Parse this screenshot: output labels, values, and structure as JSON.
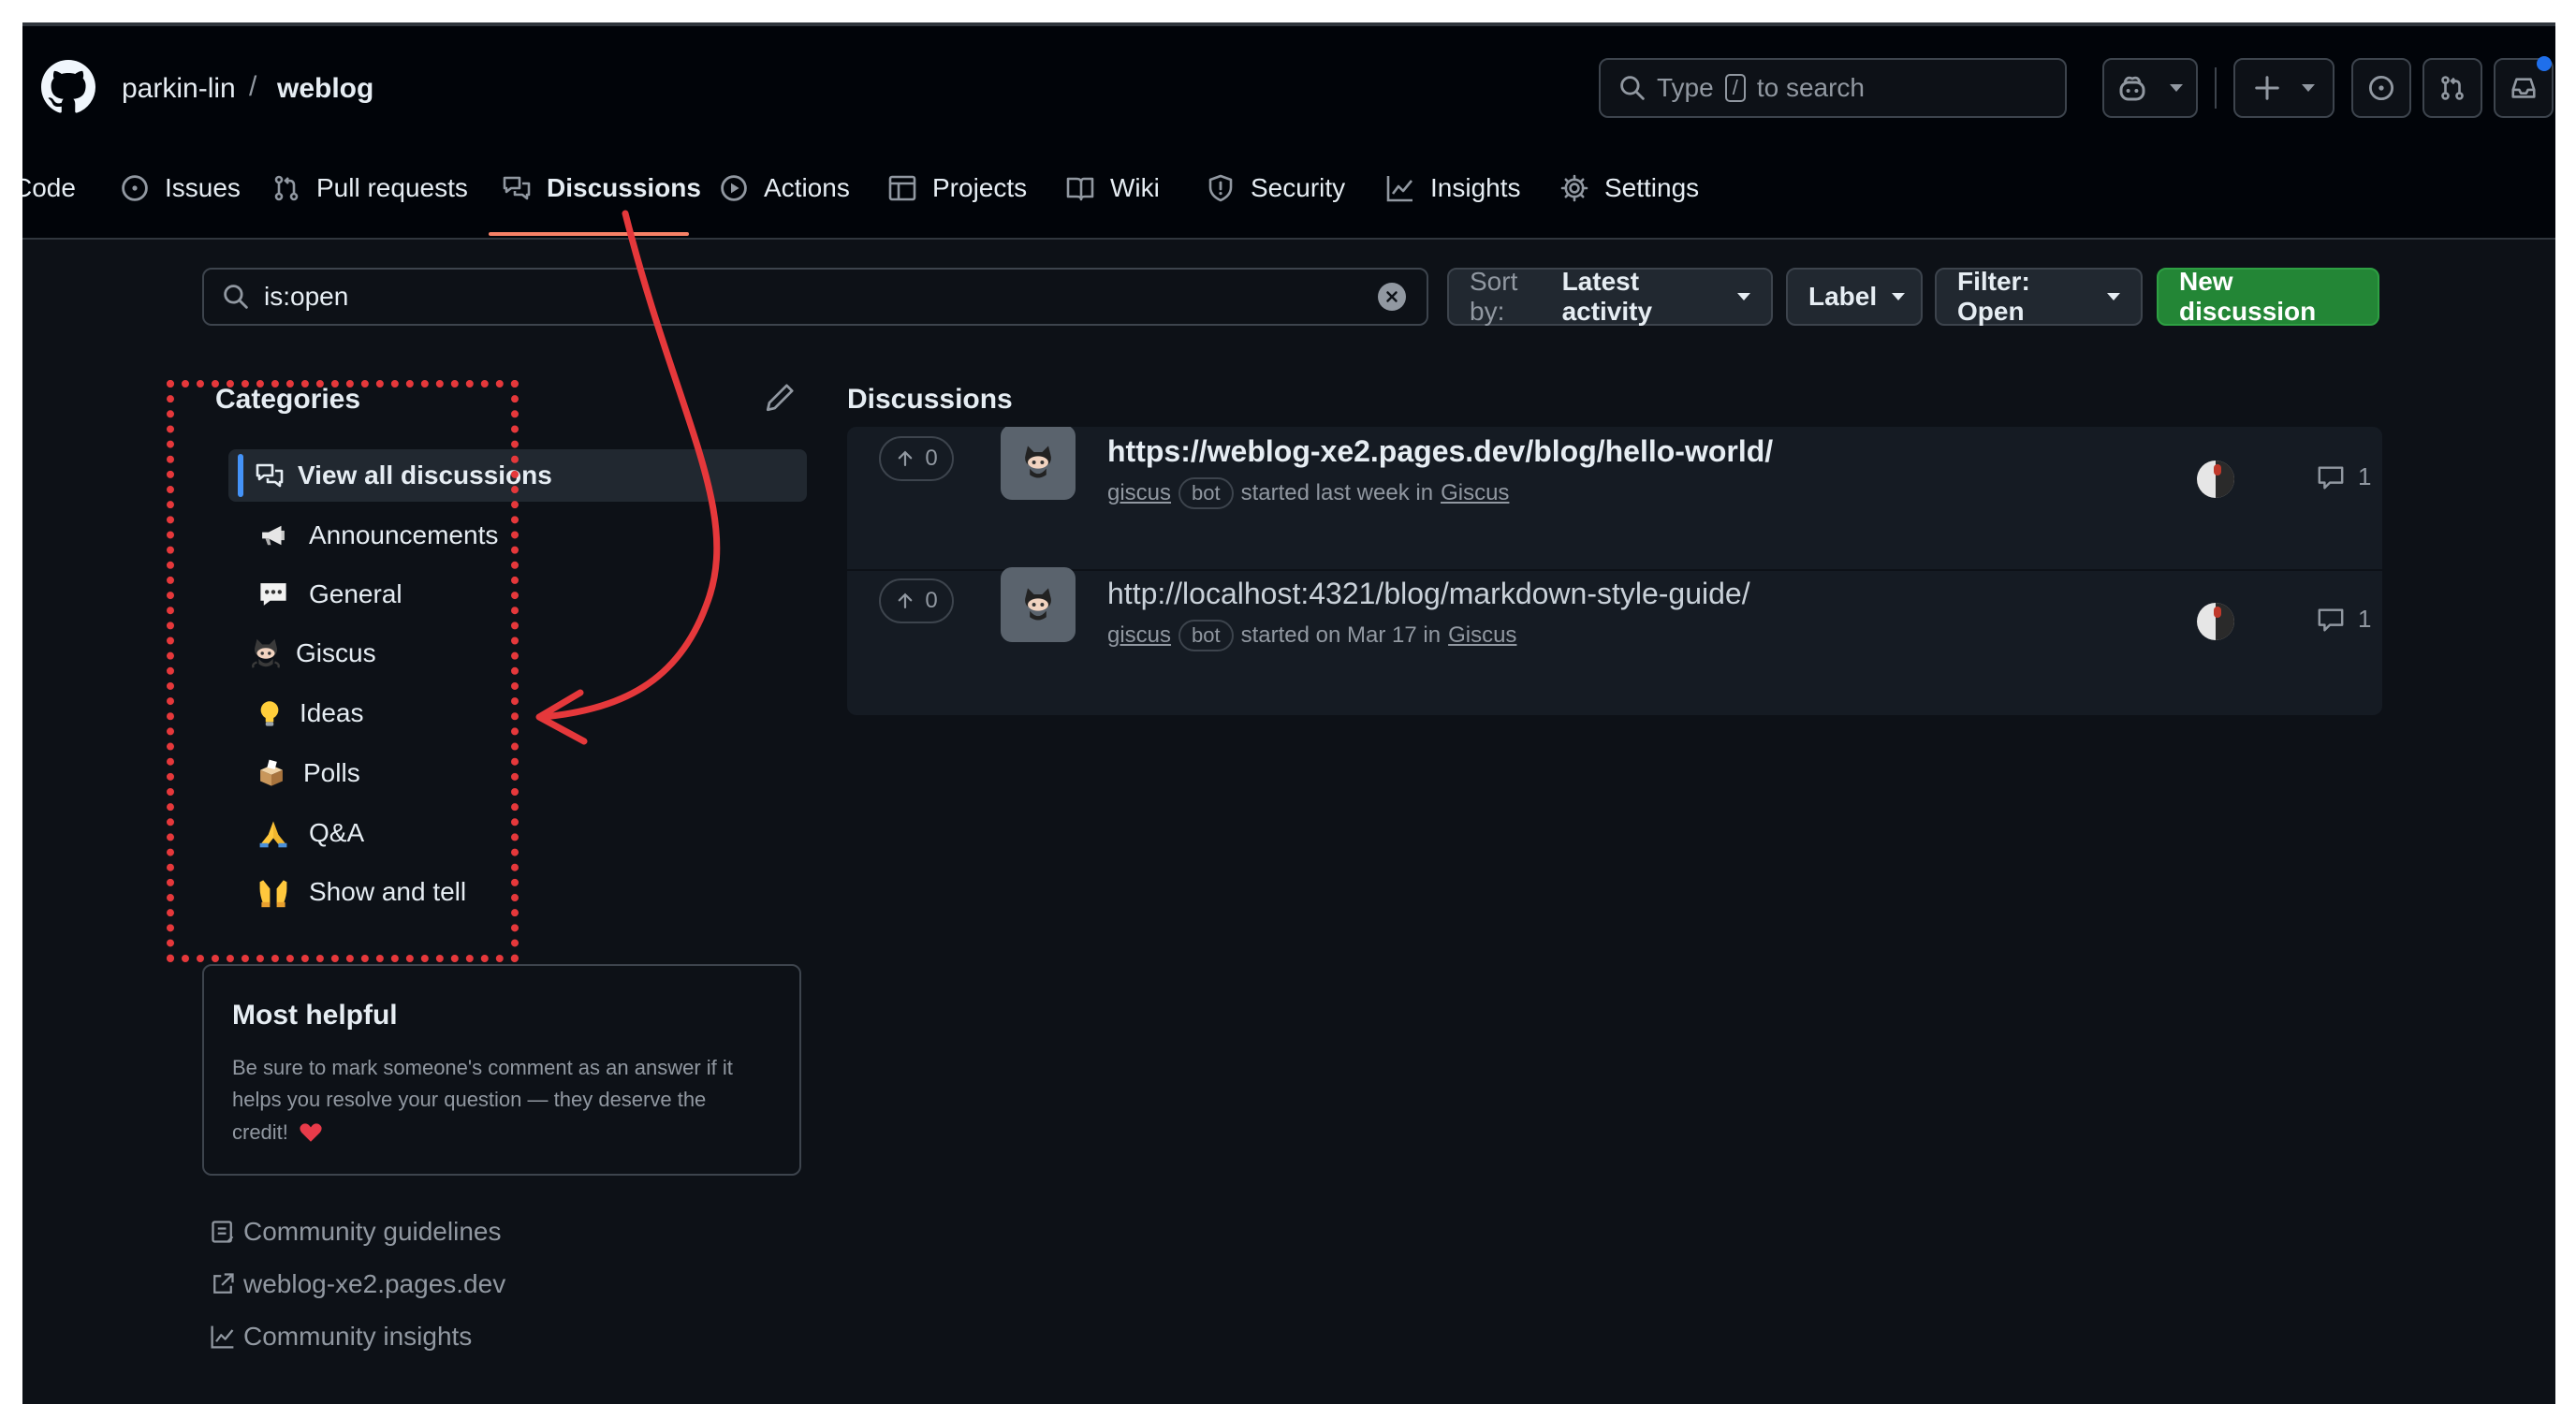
{
  "header": {
    "owner": "parkin-lin",
    "separator": "/",
    "repo": "weblog",
    "search": {
      "prefix": "Type",
      "key": "/",
      "suffix": "to search"
    },
    "notification_dot_color": "#1f6feb"
  },
  "tabs": [
    {
      "label": "Code",
      "icon": "code-icon"
    },
    {
      "label": "Issues",
      "icon": "issue-opened-icon"
    },
    {
      "label": "Pull requests",
      "icon": "git-pull-request-icon"
    },
    {
      "label": "Discussions",
      "icon": "comment-discussion-icon",
      "selected": true
    },
    {
      "label": "Actions",
      "icon": "play-icon"
    },
    {
      "label": "Projects",
      "icon": "table-icon"
    },
    {
      "label": "Wiki",
      "icon": "book-icon"
    },
    {
      "label": "Security",
      "icon": "shield-icon"
    },
    {
      "label": "Insights",
      "icon": "graph-icon"
    },
    {
      "label": "Settings",
      "icon": "gear-icon"
    }
  ],
  "toolbar": {
    "search_value": "is:open",
    "sort_prefix": "Sort by:",
    "sort_value": "Latest activity",
    "label_button": "Label",
    "filter_button": "Filter: Open",
    "new_discussion": "New discussion",
    "accent_green": "#238636"
  },
  "categories": {
    "title": "Categories",
    "items": [
      {
        "label": "View all discussions",
        "emoji": "discussion-outline-icon",
        "selected": true
      },
      {
        "label": "Announcements",
        "emoji": "megaphone-emoji"
      },
      {
        "label": "General",
        "emoji": "speech-balloon-emoji"
      },
      {
        "label": "Giscus",
        "emoji": "octocat-emoji"
      },
      {
        "label": "Ideas",
        "emoji": "lightbulb-emoji"
      },
      {
        "label": "Polls",
        "emoji": "ballot-box-emoji"
      },
      {
        "label": "Q&A",
        "emoji": "folded-hands-emoji"
      },
      {
        "label": "Show and tell",
        "emoji": "raising-hands-emoji"
      }
    ]
  },
  "most_helpful": {
    "title": "Most helpful",
    "body_line1": "Be sure to mark someone's comment as an answer if it",
    "body_line2": "helps you resolve your question — they deserve the",
    "body_line3": "credit!"
  },
  "footer_links": [
    {
      "label": "Community guidelines",
      "icon": "note-icon"
    },
    {
      "label": "weblog-xe2.pages.dev",
      "icon": "link-external-icon"
    },
    {
      "label": "Community insights",
      "icon": "graph-icon"
    }
  ],
  "discussions": {
    "heading": "Discussions",
    "rows": [
      {
        "votes": "0",
        "title": "https://weblog-xe2.pages.dev/blog/hello-world/",
        "author": "giscus",
        "badge": "bot",
        "started": "started last week in",
        "category": "Giscus",
        "comments": "1"
      },
      {
        "votes": "0",
        "title": "http://localhost:4321/blog/markdown-style-guide/",
        "author": "giscus",
        "badge": "bot",
        "started": "started on Mar 17 in",
        "category": "Giscus",
        "comments": "1"
      }
    ]
  },
  "annotation": {
    "color": "#e5383b"
  }
}
